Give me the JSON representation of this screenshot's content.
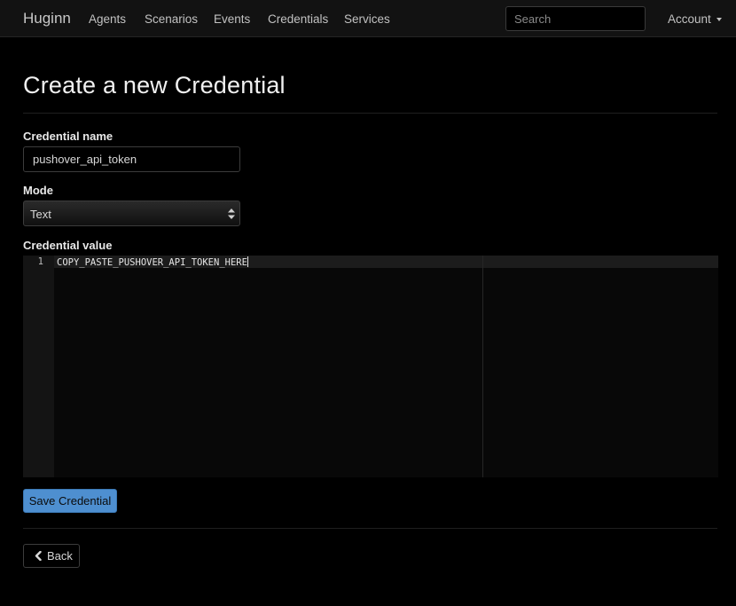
{
  "navbar": {
    "brand": "Huginn",
    "links": [
      "Agents",
      "Scenarios",
      "Events",
      "Credentials",
      "Services"
    ],
    "search_placeholder": "Search",
    "account_label": "Account"
  },
  "page": {
    "title": "Create a new Credential"
  },
  "form": {
    "name_label": "Credential name",
    "name_value": "pushover_api_token",
    "mode_label": "Mode",
    "mode_value": "Text",
    "value_label": "Credential value",
    "editor": {
      "line_number": "1",
      "code": "COPY_PASTE_PUSHOVER_API_TOKEN_HERE"
    },
    "save_label": "Save Credential"
  },
  "back_label": "Back",
  "icons": {
    "account_caret": "caret-down-icon",
    "select_arrows": "select-arrows-icon",
    "back": "chevron-left-icon"
  },
  "colors": {
    "background": "#000000",
    "navbar": "#121212",
    "primary_button": "#4e8fd0"
  }
}
